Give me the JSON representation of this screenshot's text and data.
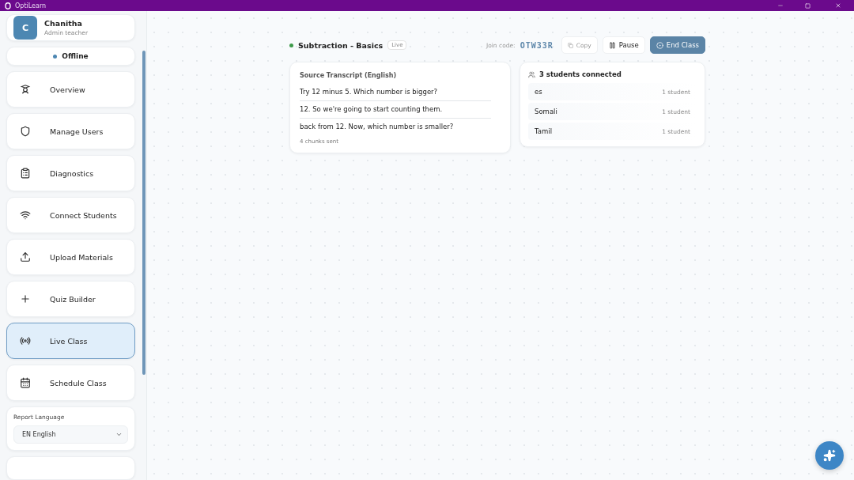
{
  "window": {
    "title": "OptiLearn"
  },
  "profile": {
    "initial": "C",
    "name": "Chanitha",
    "role": "Admin teacher"
  },
  "status": {
    "label": "Offline"
  },
  "nav": [
    {
      "label": "Overview",
      "selected": false
    },
    {
      "label": "Manage Users",
      "selected": false
    },
    {
      "label": "Diagnostics",
      "selected": false
    },
    {
      "label": "Connect Students",
      "selected": false
    },
    {
      "label": "Upload Materials",
      "selected": false
    },
    {
      "label": "Quiz Builder",
      "selected": false
    },
    {
      "label": "Live Class",
      "selected": true
    },
    {
      "label": "Schedule Class",
      "selected": false
    }
  ],
  "report_language": {
    "label": "Report Language",
    "value": "EN English"
  },
  "session": {
    "title": "Subtraction - Basics",
    "badge": "Live",
    "join_label": "Join code:",
    "join_code": "OTW33R",
    "copy": "Copy",
    "pause": "Pause",
    "end": "End Class"
  },
  "transcript": {
    "title": "Source Transcript (English)",
    "lines": [
      "Try 12 minus 5. Which number is bigger?",
      "12. So we're going to start counting them.",
      "back from 12. Now, which number is smaller?"
    ],
    "footer": "4 chunks sent"
  },
  "students": {
    "title": "3 students connected",
    "rows": [
      {
        "language": "es",
        "count": "1 student"
      },
      {
        "language": "Somali",
        "count": "1 student"
      },
      {
        "language": "Tamil",
        "count": "1 student"
      }
    ]
  }
}
